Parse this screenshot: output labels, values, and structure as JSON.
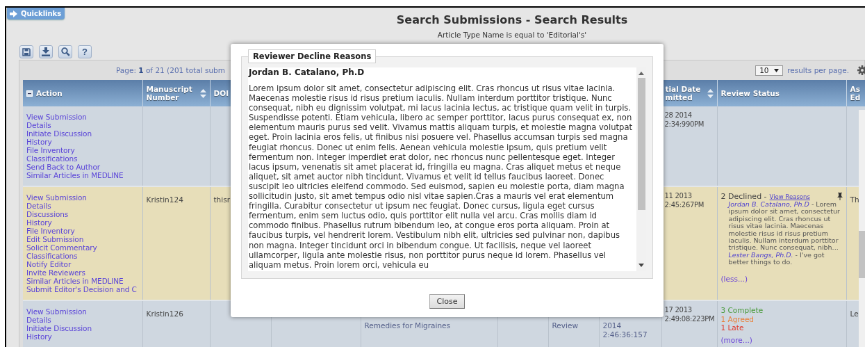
{
  "quicklinks": {
    "label": "Quicklinks"
  },
  "page_title": "Search Submissions - Search Results",
  "filter_summary": "Article Type Name is equal to 'Editorial's'",
  "toolbar": [
    {
      "kind": "save"
    },
    {
      "kind": "download"
    },
    {
      "kind": "search"
    },
    {
      "kind": "help",
      "label": "?"
    }
  ],
  "pager": {
    "info": "Page: **1** of 21 (201 total subm",
    "per_page": "10",
    "per_page_label": "results per page."
  },
  "table": {
    "header": {
      "action": {
        "label": "Action"
      },
      "manuscript_number": {
        "label": "Manuscript Number",
        "sortable": true
      },
      "doi": {
        "label": "DOI"
      },
      "column_9": {
        "label": "tial Date mitted",
        "sortable": true
      },
      "review_status": {
        "label": "Review Status"
      },
      "column_11": {
        "label": "As Ed"
      }
    },
    "rows": [
      {
        "selected": false,
        "actions": [
          "View Submission",
          "Details",
          "Initiate Discussion",
          "History",
          "File Inventory",
          "Classifications",
          "Send Back to Author",
          "Similar Articles in MEDLINE"
        ],
        "column_9": [
          "28 2014",
          "2:34:990PM"
        ]
      },
      {
        "selected": true,
        "actions": [
          "View Submission",
          "Details",
          "Discussions",
          "History",
          "File Inventory",
          "Edit Submission",
          "Solicit Commentary",
          "Classifications",
          "Notify Editor",
          "Invite Reviewers",
          "Similar Articles in MEDLINE",
          "Submit Editor's Decision and C"
        ],
        "manuscript_number": "Kristin124",
        "doi": "thisr",
        "column_9": [
          "11 2013",
          "2:45:267PM"
        ],
        "review_status": {
          "kind": "declined",
          "summary": "2 Declined -",
          "link": "View Reasons",
          "pinned": true,
          "reasons": [
            {
              "reviewer": "Jordan B. Catalano, Ph.D",
              "text": "- Lorem ipsum dolor sit amet, consectetur adipiscing elit. Cras rhoncus ut risus vitae lacinia. Maecenas molestie risus id risus pretium iaculis. Nullam interdum porttitor tristique. Nunc consequat, nibh..."
            },
            {
              "reviewer": "Lester Bangs, Ph.D.",
              "text": "- I've got better things to do."
            }
          ],
          "toggle": "(less...)"
        },
        "column_11": "Th"
      },
      {
        "selected": false,
        "actions": [
          "View Submission",
          "Details",
          "Initiate Discussion",
          "History"
        ],
        "manuscript_number": "Kristin126",
        "column_5": "Remedies for Migraines",
        "column_7": "Review",
        "column_8": [
          "2014",
          "2:46:36:157"
        ],
        "column_9": [
          "17 2013",
          "2:49:08:223PM"
        ],
        "review_status": {
          "kind": "counts",
          "counts": [
            {
              "label": "3 Complete",
              "color": "#4a9a3c"
            },
            {
              "label": "1 Agreed",
              "color": "#e8803a"
            },
            {
              "label": "1 Late",
              "color": "#e03a2a"
            }
          ],
          "toggle": "(more...)"
        },
        "column_11": "Le"
      }
    ]
  },
  "modal": {
    "title": "Reviewer Decline Reasons",
    "reviewer": "Jordan B. Catalano, Ph.D",
    "reason": "Lorem ipsum dolor sit amet, consectetur adipiscing elit. Cras rhoncus ut risus vitae lacinia. Maecenas molestie risus id risus pretium iaculis. Nullam interdum porttitor tristique. Nunc consequat, nibh eu dignissim volutpat, mi lacus lacinia lectus, ac tristique quam velit in turpis. Suspendisse potenti. Etiam vehicula, libero ac semper porttitor, lacus purus consequat ex, non elementum mauris purus sed velit. Vivamus mattis aliquam turpis, et molestie magna volutpat eget. Proin lacinia eros felis, ut finibus nisi posuere vel. Phasellus accumsan turpis sed magna feugiat rhoncus. Donec ut enim felis. Aenean vehicula molestie ipsum, quis pretium velit fermentum non. Integer imperdiet erat dolor, nec rhoncus nunc pellentesque eget. Integer lacus ipsum, venenatis sit amet placerat id, fringilla eu magna. Cras aliquet metus et neque aliquet, sit amet auctor nibh tincidunt. Vivamus et velit id tellus faucibus laoreet. Donec suscipit leo ultricies eleifend commodo. Sed euismod, sapien eu molestie porta, diam magna sollicitudin justo, sit amet tempus odio nisl vitae sapien.Cras a mauris vel erat elementum fringilla. Curabitur consectetur ut ipsum nec feugiat. Donec cursus, ligula eget cursus fermentum, enim sem luctus odio, quis porttitor elit nulla vel arcu. Cras mollis diam id commodo finibus. Phasellus rutrum bibendum leo, at congue eros porta aliquam. Proin at faucibus turpis, vel hendrerit lorem. Vestibulum nibh elit, ultricies sed pulvinar non, dapibus non magna. Integer tincidunt orci in bibendum congue. Ut facilisis, neque vel laoreet ullamcorper, ligula ante molestie risus, non porttitor purus neque id lorem. Phasellus vel aliquam metus. Proin lorem orci, vehicula eu",
    "close": "Close"
  }
}
